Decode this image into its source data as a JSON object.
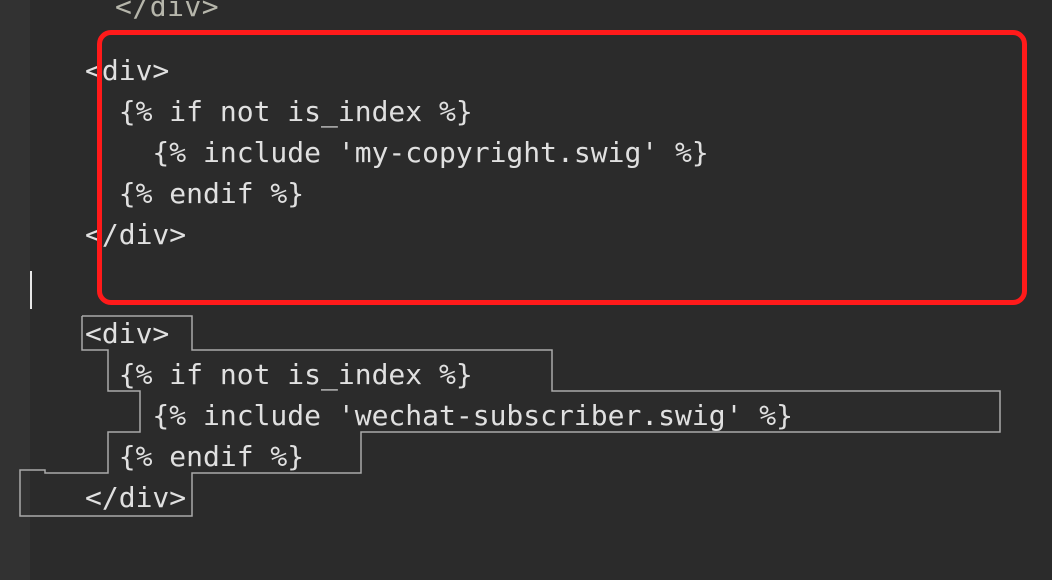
{
  "top_fragment": "</div>",
  "block1": {
    "l1": "<div>",
    "l2": "  {% if not is_index %}",
    "l3": "    {% include 'my-copyright.swig' %}",
    "l4": "  {% endif %}",
    "l5": "</div>"
  },
  "block2": {
    "l1": "<div>",
    "l2": "  {% if not is_index %}",
    "l3": "    {% include 'wechat-subscriber.swig' %}",
    "l4": "  {% endif %}",
    "l5": "</div>"
  }
}
